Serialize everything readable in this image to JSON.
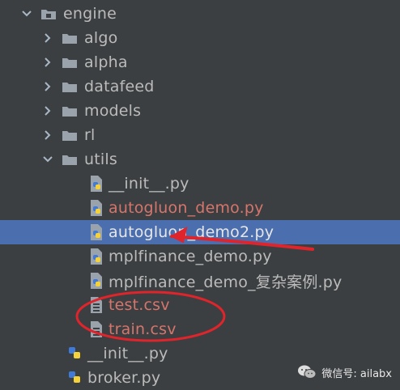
{
  "tree": {
    "root": {
      "label": "engine"
    },
    "folders": [
      {
        "label": "algo"
      },
      {
        "label": "alpha"
      },
      {
        "label": "datafeed"
      },
      {
        "label": "models"
      },
      {
        "label": "rl"
      },
      {
        "label": "utils"
      }
    ],
    "utils_files": [
      {
        "label": "__init__.py",
        "status": "normal"
      },
      {
        "label": "autogluon_demo.py",
        "status": "modified"
      },
      {
        "label": "autogluon_demo2.py",
        "status": "selected"
      },
      {
        "label": "mplfinance_demo.py",
        "status": "normal"
      },
      {
        "label": "mplfinance_demo_复杂案例.py",
        "status": "normal"
      },
      {
        "label": "test.csv",
        "status": "modified"
      },
      {
        "label": "train.csv",
        "status": "modified"
      }
    ],
    "engine_files": [
      {
        "label": "__init__.py"
      },
      {
        "label": "broker.py"
      }
    ]
  },
  "colors": {
    "background": "#3c3f41",
    "selection": "#4b6eaf",
    "text": "#bbbbbb",
    "modified_text": "#d5756c",
    "annotation_red": "#e0242b"
  },
  "icons": {
    "folder": "folder-icon",
    "python_file": "python-file-icon",
    "csv_file": "csv-file-icon",
    "expand": "chevron-down-icon",
    "collapse": "chevron-right-icon"
  },
  "watermark": {
    "label": "微信号: ailabx"
  }
}
